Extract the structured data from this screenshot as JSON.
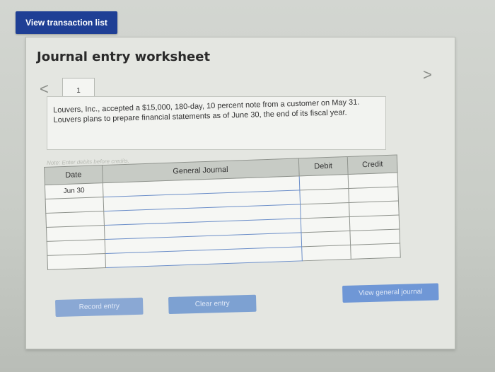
{
  "header": {
    "view_transaction_list": "View transaction list"
  },
  "worksheet": {
    "title": "Journal entry worksheet",
    "active_tab": "1",
    "nav_prev": "<",
    "nav_next": ">",
    "description": "Louvers, Inc., accepted a $15,000, 180-day, 10 percent note from a customer on May 31. Louvers plans to prepare financial statements as of June 30, the end of its fiscal year.",
    "note": "Note: Enter debits before credits."
  },
  "journal": {
    "columns": [
      "Date",
      "General Journal",
      "Debit",
      "Credit"
    ],
    "rows": [
      {
        "date": "Jun 30",
        "account": "",
        "debit": "",
        "credit": ""
      },
      {
        "date": "",
        "account": "",
        "debit": "",
        "credit": ""
      },
      {
        "date": "",
        "account": "",
        "debit": "",
        "credit": ""
      },
      {
        "date": "",
        "account": "",
        "debit": "",
        "credit": ""
      },
      {
        "date": "",
        "account": "",
        "debit": "",
        "credit": ""
      },
      {
        "date": "",
        "account": "",
        "debit": "",
        "credit": ""
      }
    ]
  },
  "buttons": {
    "record_entry": "Record entry",
    "clear_entry": "Clear entry",
    "view_general_journal": "View general journal"
  }
}
